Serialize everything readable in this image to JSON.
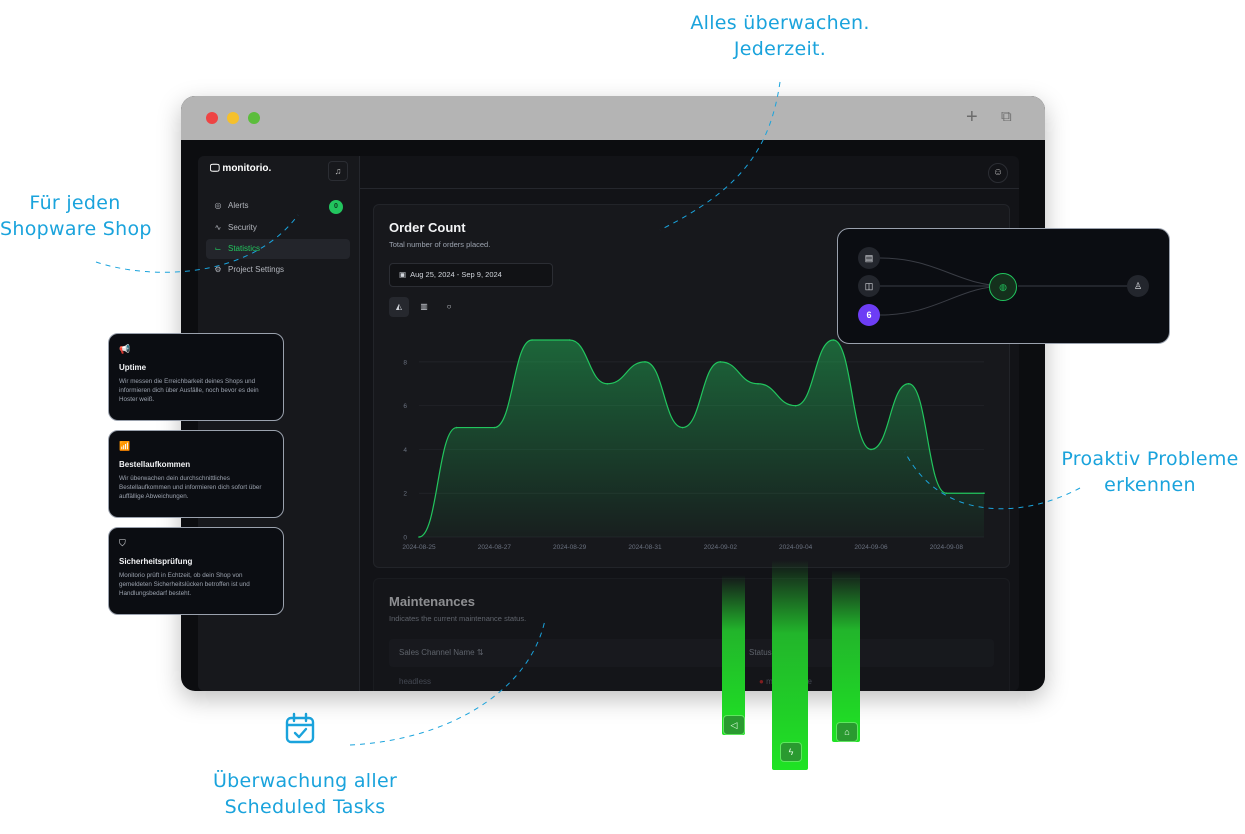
{
  "annotations": {
    "monitor_all_line1": "Alles überwachen.",
    "monitor_all_line2": "Jederzeit.",
    "every_shop_line1": "Für jeden",
    "every_shop_line2": "Shopware Shop",
    "proactive_line1": "Proaktiv Probleme",
    "proactive_line2": "erkennen",
    "tasks_line1": "Überwachung aller",
    "tasks_line2": "Scheduled Tasks"
  },
  "window": {
    "controls": {
      "new_tab": "+",
      "tabs": "⧉"
    },
    "traffic_colors": [
      "#ee4444",
      "#f5c02c",
      "#5cbd3c"
    ]
  },
  "app": {
    "brand": "monitorio.",
    "sidebar": {
      "items": [
        {
          "label": "Alerts",
          "icon": "radar-icon"
        },
        {
          "label": "Security",
          "icon": "activity-icon"
        },
        {
          "label": "Statistics",
          "icon": "chart-icon"
        },
        {
          "label": "Project Settings",
          "icon": "gear-icon"
        }
      ],
      "alerts_badge": "0"
    },
    "accent": "#22c55e"
  },
  "order_card": {
    "title": "Order Count",
    "subtitle": "Total number of orders placed.",
    "date_range": "Aug 25, 2024 - Sep 9, 2024"
  },
  "chart_data": {
    "type": "area",
    "x": [
      "2024-08-25",
      "2024-08-26",
      "2024-08-27",
      "2024-08-28",
      "2024-08-29",
      "2024-08-30",
      "2024-08-31",
      "2024-09-01",
      "2024-09-02",
      "2024-09-03",
      "2024-09-04",
      "2024-09-05",
      "2024-09-06",
      "2024-09-07",
      "2024-09-08",
      "2024-09-09"
    ],
    "xticks": [
      "2024-08-25",
      "2024-08-27",
      "2024-08-29",
      "2024-08-31",
      "2024-09-02",
      "2024-09-04",
      "2024-09-06",
      "2024-09-08"
    ],
    "values": [
      0,
      5,
      5,
      9,
      9,
      7,
      8,
      5,
      8,
      7,
      6,
      9,
      4,
      7,
      2,
      2
    ],
    "yticks": [
      0,
      2,
      4,
      6,
      8
    ],
    "ylim": [
      0,
      9
    ],
    "grid": true,
    "color": "#22c55e"
  },
  "maintenance_card": {
    "title": "Maintenances",
    "subtitle": "Indicates the current maintenance status.",
    "col_name": "Sales Channel Name ⇅",
    "col_status": "Status",
    "row_name": "headless",
    "row_status": "maintenance"
  },
  "features": [
    {
      "icon": "megaphone-icon",
      "title": "Uptime",
      "text": "Wir messen die Erreichbarkeit deines Shops und informieren dich über Ausfälle, noch bevor es dein Hoster weiß."
    },
    {
      "icon": "signal-icon",
      "title": "Bestellaufkommen",
      "text": "Wir überwachen dein durchschnittliches Bestellaufkommen und informieren dich sofort über auffällige Abweichungen."
    },
    {
      "icon": "shield-icon",
      "title": "Sicherheitsprüfung",
      "text": "Monitorio prüft in Echtzeit, ob dein Shop von gemeldeten Sicherheitslücken betroffen ist und Handlungsbedarf besteht."
    }
  ],
  "flow": {
    "shopware_badge": "6"
  }
}
